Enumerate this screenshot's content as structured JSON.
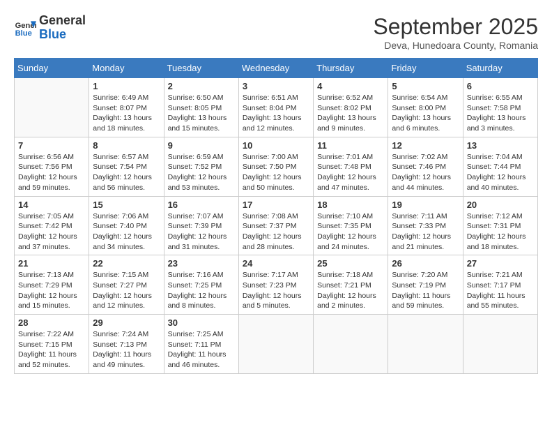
{
  "logo": {
    "general": "General",
    "blue": "Blue"
  },
  "title": "September 2025",
  "location": "Deva, Hunedoara County, Romania",
  "days_of_week": [
    "Sunday",
    "Monday",
    "Tuesday",
    "Wednesday",
    "Thursday",
    "Friday",
    "Saturday"
  ],
  "weeks": [
    [
      {
        "day": "",
        "info": ""
      },
      {
        "day": "1",
        "info": "Sunrise: 6:49 AM\nSunset: 8:07 PM\nDaylight: 13 hours\nand 18 minutes."
      },
      {
        "day": "2",
        "info": "Sunrise: 6:50 AM\nSunset: 8:05 PM\nDaylight: 13 hours\nand 15 minutes."
      },
      {
        "day": "3",
        "info": "Sunrise: 6:51 AM\nSunset: 8:04 PM\nDaylight: 13 hours\nand 12 minutes."
      },
      {
        "day": "4",
        "info": "Sunrise: 6:52 AM\nSunset: 8:02 PM\nDaylight: 13 hours\nand 9 minutes."
      },
      {
        "day": "5",
        "info": "Sunrise: 6:54 AM\nSunset: 8:00 PM\nDaylight: 13 hours\nand 6 minutes."
      },
      {
        "day": "6",
        "info": "Sunrise: 6:55 AM\nSunset: 7:58 PM\nDaylight: 13 hours\nand 3 minutes."
      }
    ],
    [
      {
        "day": "7",
        "info": "Sunrise: 6:56 AM\nSunset: 7:56 PM\nDaylight: 12 hours\nand 59 minutes."
      },
      {
        "day": "8",
        "info": "Sunrise: 6:57 AM\nSunset: 7:54 PM\nDaylight: 12 hours\nand 56 minutes."
      },
      {
        "day": "9",
        "info": "Sunrise: 6:59 AM\nSunset: 7:52 PM\nDaylight: 12 hours\nand 53 minutes."
      },
      {
        "day": "10",
        "info": "Sunrise: 7:00 AM\nSunset: 7:50 PM\nDaylight: 12 hours\nand 50 minutes."
      },
      {
        "day": "11",
        "info": "Sunrise: 7:01 AM\nSunset: 7:48 PM\nDaylight: 12 hours\nand 47 minutes."
      },
      {
        "day": "12",
        "info": "Sunrise: 7:02 AM\nSunset: 7:46 PM\nDaylight: 12 hours\nand 44 minutes."
      },
      {
        "day": "13",
        "info": "Sunrise: 7:04 AM\nSunset: 7:44 PM\nDaylight: 12 hours\nand 40 minutes."
      }
    ],
    [
      {
        "day": "14",
        "info": "Sunrise: 7:05 AM\nSunset: 7:42 PM\nDaylight: 12 hours\nand 37 minutes."
      },
      {
        "day": "15",
        "info": "Sunrise: 7:06 AM\nSunset: 7:40 PM\nDaylight: 12 hours\nand 34 minutes."
      },
      {
        "day": "16",
        "info": "Sunrise: 7:07 AM\nSunset: 7:39 PM\nDaylight: 12 hours\nand 31 minutes."
      },
      {
        "day": "17",
        "info": "Sunrise: 7:08 AM\nSunset: 7:37 PM\nDaylight: 12 hours\nand 28 minutes."
      },
      {
        "day": "18",
        "info": "Sunrise: 7:10 AM\nSunset: 7:35 PM\nDaylight: 12 hours\nand 24 minutes."
      },
      {
        "day": "19",
        "info": "Sunrise: 7:11 AM\nSunset: 7:33 PM\nDaylight: 12 hours\nand 21 minutes."
      },
      {
        "day": "20",
        "info": "Sunrise: 7:12 AM\nSunset: 7:31 PM\nDaylight: 12 hours\nand 18 minutes."
      }
    ],
    [
      {
        "day": "21",
        "info": "Sunrise: 7:13 AM\nSunset: 7:29 PM\nDaylight: 12 hours\nand 15 minutes."
      },
      {
        "day": "22",
        "info": "Sunrise: 7:15 AM\nSunset: 7:27 PM\nDaylight: 12 hours\nand 12 minutes."
      },
      {
        "day": "23",
        "info": "Sunrise: 7:16 AM\nSunset: 7:25 PM\nDaylight: 12 hours\nand 8 minutes."
      },
      {
        "day": "24",
        "info": "Sunrise: 7:17 AM\nSunset: 7:23 PM\nDaylight: 12 hours\nand 5 minutes."
      },
      {
        "day": "25",
        "info": "Sunrise: 7:18 AM\nSunset: 7:21 PM\nDaylight: 12 hours\nand 2 minutes."
      },
      {
        "day": "26",
        "info": "Sunrise: 7:20 AM\nSunset: 7:19 PM\nDaylight: 11 hours\nand 59 minutes."
      },
      {
        "day": "27",
        "info": "Sunrise: 7:21 AM\nSunset: 7:17 PM\nDaylight: 11 hours\nand 55 minutes."
      }
    ],
    [
      {
        "day": "28",
        "info": "Sunrise: 7:22 AM\nSunset: 7:15 PM\nDaylight: 11 hours\nand 52 minutes."
      },
      {
        "day": "29",
        "info": "Sunrise: 7:24 AM\nSunset: 7:13 PM\nDaylight: 11 hours\nand 49 minutes."
      },
      {
        "day": "30",
        "info": "Sunrise: 7:25 AM\nSunset: 7:11 PM\nDaylight: 11 hours\nand 46 minutes."
      },
      {
        "day": "",
        "info": ""
      },
      {
        "day": "",
        "info": ""
      },
      {
        "day": "",
        "info": ""
      },
      {
        "day": "",
        "info": ""
      }
    ]
  ]
}
